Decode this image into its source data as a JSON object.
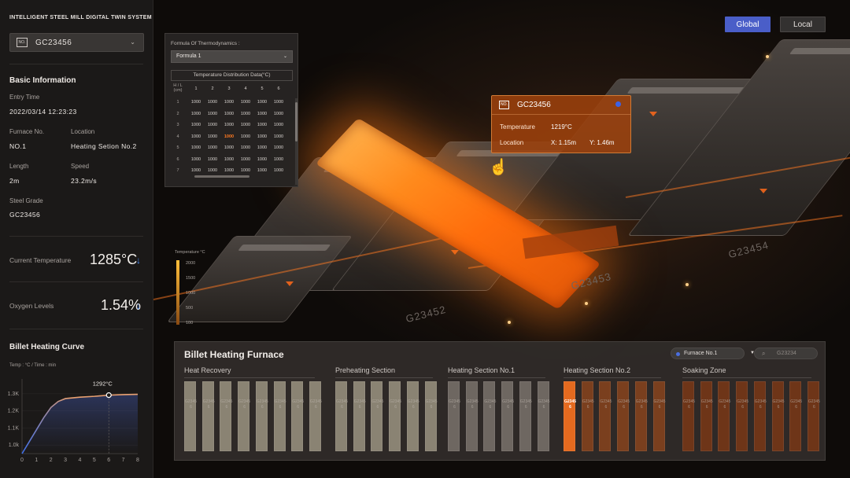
{
  "app_title": "INTELLIGENT STEEL MILL DIGITAL TWIN SYSTEM",
  "selector": {
    "badge": "NO.",
    "value": "GC23456"
  },
  "basic_info": {
    "heading": "Basic Information",
    "entry_time_label": "Entry Time",
    "entry_time": "2022/03/14 12:23:23",
    "furnace_label": "Furnace No.",
    "furnace": "NO.1",
    "location_label": "Location",
    "location": "Heating Setion No.2",
    "length_label": "Length",
    "length": "2m",
    "speed_label": "Speed",
    "speed": "23.2m/s",
    "grade_label": "Steel Grade",
    "grade": "GC23456"
  },
  "metrics": {
    "current_temp_label": "Current Temperature",
    "current_temp": "1285°C",
    "oxygen_label": "Oxygen Levels",
    "oxygen": "1.54%"
  },
  "curve": {
    "title": "Billet Heating Curve",
    "units": "Temp : °C / Time : min",
    "marker_label": "1292°C",
    "y_ticks": [
      "1.3K",
      "1.2K",
      "1.1K",
      "1.0k"
    ],
    "x_ticks": [
      "0",
      "1",
      "2",
      "3",
      "4",
      "5",
      "6",
      "7",
      "8"
    ],
    "colors": {
      "line_start": "#3f6fe8",
      "line_end": "#e8a070"
    }
  },
  "chart_data": {
    "type": "line",
    "title": "Billet Heating Curve",
    "xlabel": "Time : min",
    "ylabel": "Temp : °C",
    "x": [
      0,
      0.5,
      1,
      1.5,
      2,
      2.5,
      3,
      4,
      5,
      6,
      7,
      8
    ],
    "y": [
      950,
      1020,
      1090,
      1160,
      1220,
      1255,
      1272,
      1280,
      1285,
      1292,
      1295,
      1297
    ],
    "xlim": [
      0,
      8
    ],
    "ylim": [
      950,
      1350
    ],
    "annotations": [
      {
        "x": 6,
        "y": 1292,
        "text": "1292°C"
      }
    ]
  },
  "view_buttons": {
    "global": "Global",
    "local": "Local"
  },
  "formula_panel": {
    "title": "Formula Of Thermodynamics :",
    "selected": "Formula 1",
    "table_caption": "Temperature Distribution Data(°C)",
    "corner": "H / L\n(cm)",
    "columns": [
      "1",
      "2",
      "3",
      "4",
      "5",
      "6"
    ],
    "rows": [
      {
        "h": "1",
        "cells": [
          "1000",
          "1000",
          "1000",
          "1000",
          "1000",
          "1000"
        ]
      },
      {
        "h": "2",
        "cells": [
          "1000",
          "1000",
          "1000",
          "1000",
          "1000",
          "1000"
        ]
      },
      {
        "h": "3",
        "cells": [
          "1000",
          "1000",
          "1000",
          "1000",
          "1000",
          "1000"
        ]
      },
      {
        "h": "4",
        "cells": [
          "1000",
          "1000",
          "1000",
          "1000",
          "1000",
          "1000"
        ]
      },
      {
        "h": "5",
        "cells": [
          "1000",
          "1000",
          "1000",
          "1000",
          "1000",
          "1000"
        ]
      },
      {
        "h": "6",
        "cells": [
          "1000",
          "1000",
          "1000",
          "1000",
          "1000",
          "1000"
        ]
      },
      {
        "h": "7",
        "cells": [
          "1000",
          "1000",
          "1000",
          "1000",
          "1000",
          "1000"
        ]
      }
    ],
    "highlight_color": "#ff7a22"
  },
  "temp_legend": {
    "title": "Temperature °C",
    "ticks": [
      "2000",
      "1500",
      "1000",
      "500",
      "100"
    ]
  },
  "tooltip": {
    "badge": "NO.",
    "id": "GC23456",
    "temp_label": "Temperature",
    "temp": "1219°C",
    "loc_label": "Location",
    "x": "X:  1.15m",
    "y": "Y:  1.46m"
  },
  "scene_labels": [
    "G23452",
    "G23453",
    "G23454"
  ],
  "furnace_panel": {
    "title": "Billet Heating Furnace",
    "furnace_select": "Furnace No.1",
    "search_value": "G23234",
    "zones": [
      {
        "name": "Heat Recovery",
        "slots": 8,
        "color": "#8a8373"
      },
      {
        "name": "Preheating Section",
        "slots": 6,
        "color": "#8a8373"
      },
      {
        "name": "Heating Section No.1",
        "slots": 6,
        "color": "#6e6761"
      },
      {
        "name": "Heating Section No.2",
        "slots": 6,
        "color": "#7a3f1e"
      },
      {
        "name": "Soaking Zone",
        "slots": 8,
        "color": "#6e3518"
      }
    ],
    "slot_text": "G23456",
    "active_color": "#e46a1f"
  }
}
